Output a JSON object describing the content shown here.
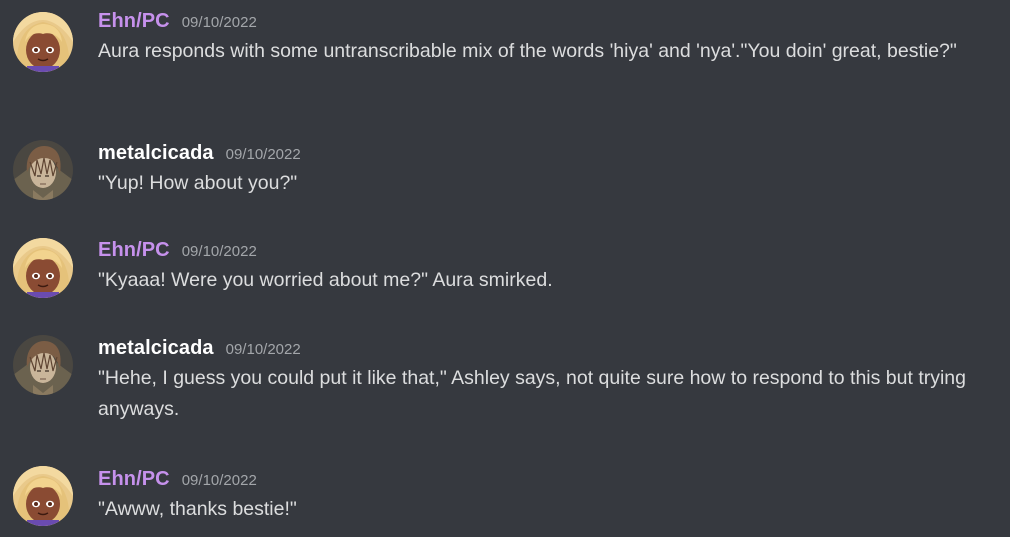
{
  "colors": {
    "background": "#36393f",
    "ehn_name": "#c691ec",
    "metal_name": "#ffffff",
    "text": "#dcddde",
    "timestamp": "#a3a6aa"
  },
  "messages": [
    {
      "author": "Ehn/PC",
      "timestamp": "09/10/2022",
      "text": "Aura responds with some untranscribable mix of the words 'hiya' and 'nya'.\"You doin' great, bestie?\"",
      "avatar": "blonde-anime-girl-avatar"
    },
    {
      "author": "metalcicada",
      "timestamp": "09/10/2022",
      "text": "\"Yup! How about you?\"",
      "avatar": "brown-haired-anime-boy-avatar"
    },
    {
      "author": "Ehn/PC",
      "timestamp": "09/10/2022",
      "text": "\"Kyaaa! Were you worried about me?\" Aura smirked.",
      "avatar": "blonde-anime-girl-avatar"
    },
    {
      "author": "metalcicada",
      "timestamp": "09/10/2022",
      "text": "\"Hehe, I guess you could put it like that,\" Ashley says, not quite sure how to respond to this but trying anyways.",
      "avatar": "brown-haired-anime-boy-avatar"
    },
    {
      "author": "Ehn/PC",
      "timestamp": "09/10/2022",
      "text": "\"Awww, thanks bestie!\"",
      "avatar": "blonde-anime-girl-avatar"
    }
  ]
}
